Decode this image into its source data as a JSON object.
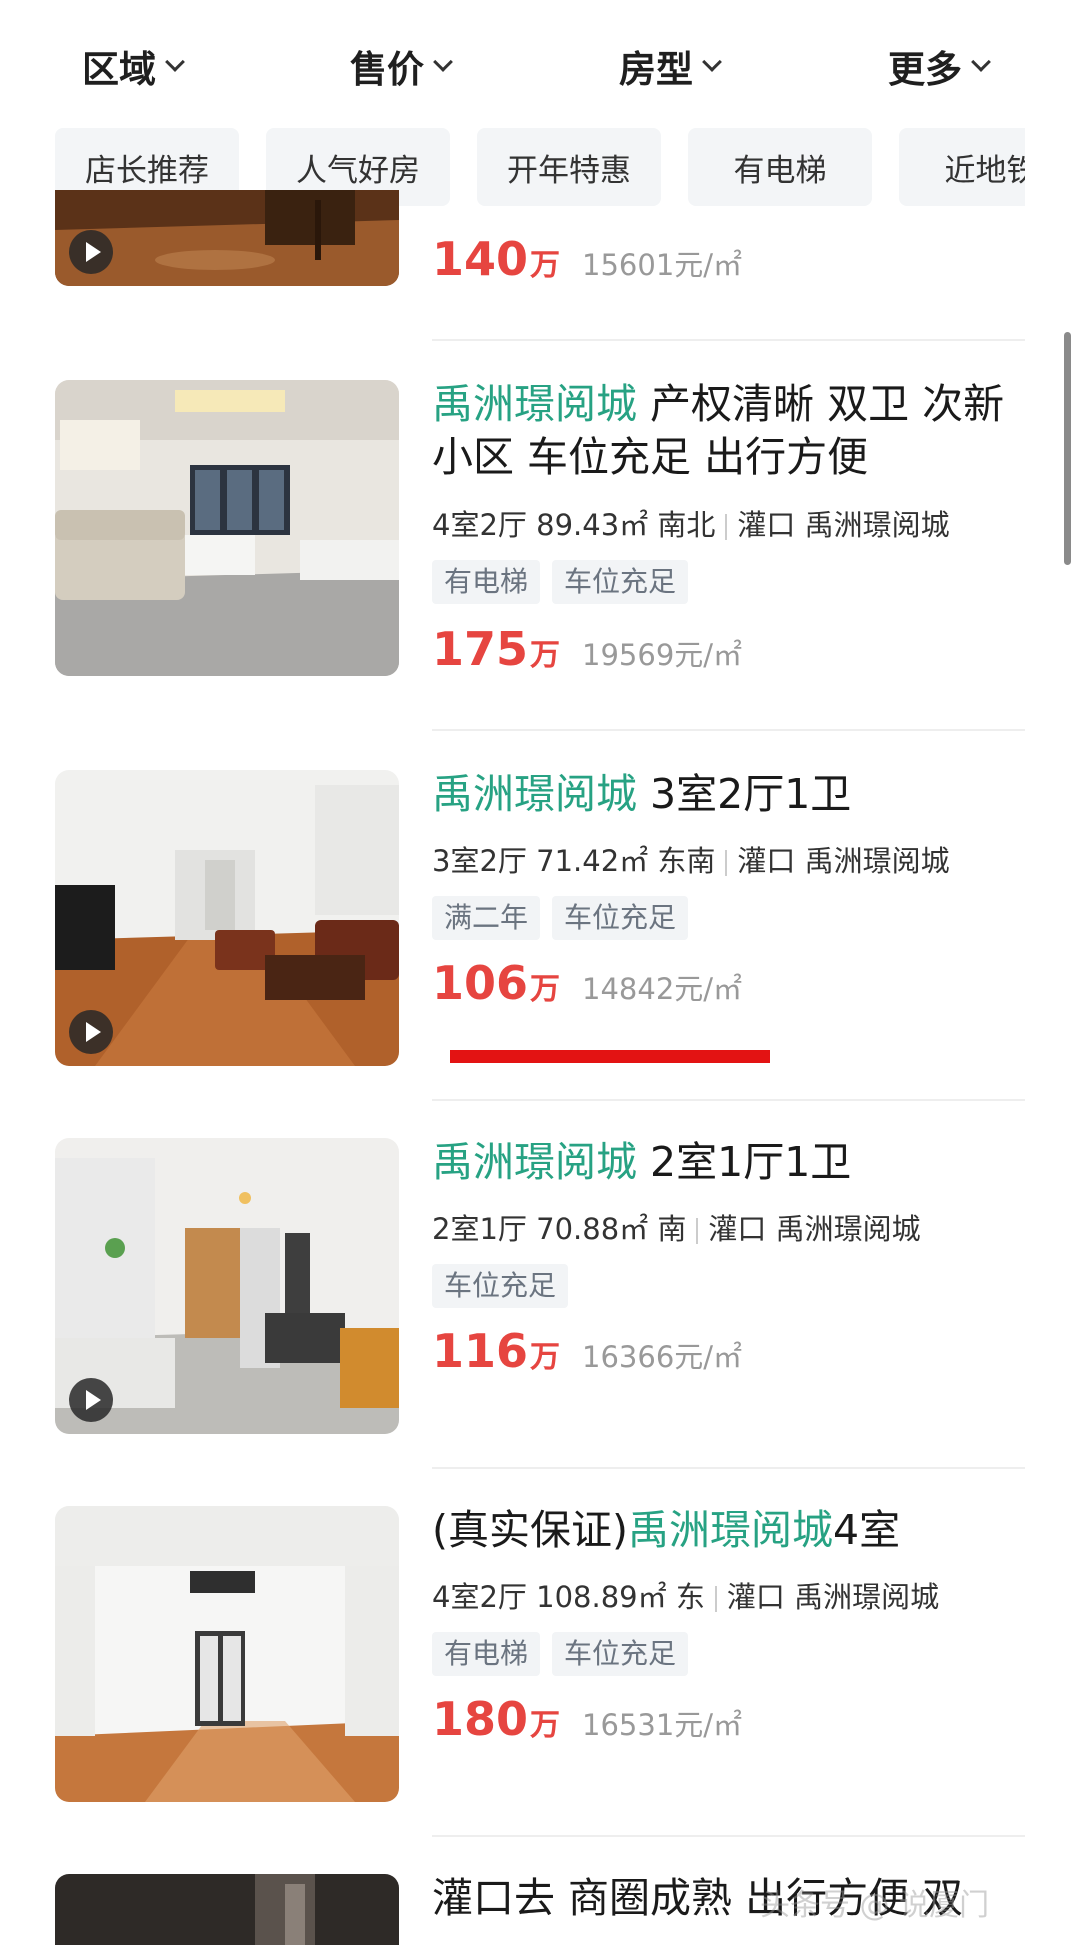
{
  "filters": [
    {
      "label": "区域"
    },
    {
      "label": "售价"
    },
    {
      "label": "房型"
    },
    {
      "label": "更多"
    }
  ],
  "quick_tags": [
    "店长推荐",
    "人气好房",
    "开年特惠",
    "有电梯",
    "近地铁"
  ],
  "listings": [
    {
      "price": "140",
      "price_unit": "万",
      "unit_price": "15601元/㎡",
      "has_video": true
    },
    {
      "title_green": "禹洲璟阅城",
      "title_rest": " 产权清晰 双卫 次新小区 车位充足 出行方便",
      "layout": "4室2厅",
      "area": "89.43㎡",
      "orientation": "南北",
      "district": "灌口",
      "community": "禹洲璟阅城",
      "tags": [
        "有电梯",
        "车位充足"
      ],
      "price": "175",
      "price_unit": "万",
      "unit_price": "19569元/㎡",
      "has_video": false
    },
    {
      "title_green": "禹洲璟阅城",
      "title_rest": " 3室2厅1卫",
      "layout": "3室2厅",
      "area": "71.42㎡",
      "orientation": "东南",
      "district": "灌口",
      "community": "禹洲璟阅城",
      "tags": [
        "满二年",
        "车位充足"
      ],
      "price": "106",
      "price_unit": "万",
      "unit_price": "14842元/㎡",
      "has_video": true
    },
    {
      "title_green": "禹洲璟阅城",
      "title_rest": " 2室1厅1卫",
      "layout": "2室1厅",
      "area": "70.88㎡",
      "orientation": "南",
      "district": "灌口",
      "community": "禹洲璟阅城",
      "tags": [
        "车位充足"
      ],
      "price": "116",
      "price_unit": "万",
      "unit_price": "16366元/㎡",
      "has_video": true
    },
    {
      "title_prefix": "(真实保证)",
      "title_green": "禹洲璟阅城",
      "title_rest": "4室",
      "layout": "4室2厅",
      "area": "108.89㎡",
      "orientation": "东",
      "district": "灌口",
      "community": "禹洲璟阅城",
      "tags": [
        "有电梯",
        "车位充足"
      ],
      "price": "180",
      "price_unit": "万",
      "unit_price": "16531元/㎡",
      "has_video": false
    },
    {
      "title_rest": "灌口去 商圈成熟 出行方便 双"
    }
  ],
  "watermark": "头条号 @ 说厦门",
  "colors": {
    "accent_green": "#27a283",
    "price_red": "#e64540",
    "tag_bg": "#f2f4f6"
  }
}
